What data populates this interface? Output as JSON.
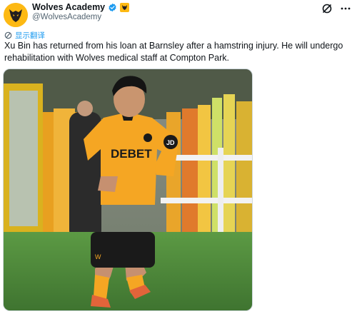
{
  "account": {
    "display_name": "Wolves Academy",
    "handle": "@WolvesAcademy",
    "avatar_icon": "wolves-crest-icon",
    "verified": true
  },
  "actions": {
    "grok_icon": "grok-icon",
    "more_icon": "more-options-icon"
  },
  "translate": {
    "label": "显示翻译",
    "icon": "translate-icon"
  },
  "tweet": {
    "text": "Xu Bin has returned from his loan at Barnsley after a hamstring injury. He will undergo rehabilitation with Wolves medical staff at Compton Park."
  },
  "photo": {
    "sponsor_text": "DEBET",
    "sleeve_badge": "JD",
    "colors": {
      "kit_gold": "#f5a623",
      "shorts_black": "#1a1a1a",
      "pitch_green": "#4f8a3a"
    }
  },
  "colors": {
    "link_blue": "#1d9bf0",
    "handle_gray": "#536471",
    "wolves_gold": "#fdb913"
  }
}
